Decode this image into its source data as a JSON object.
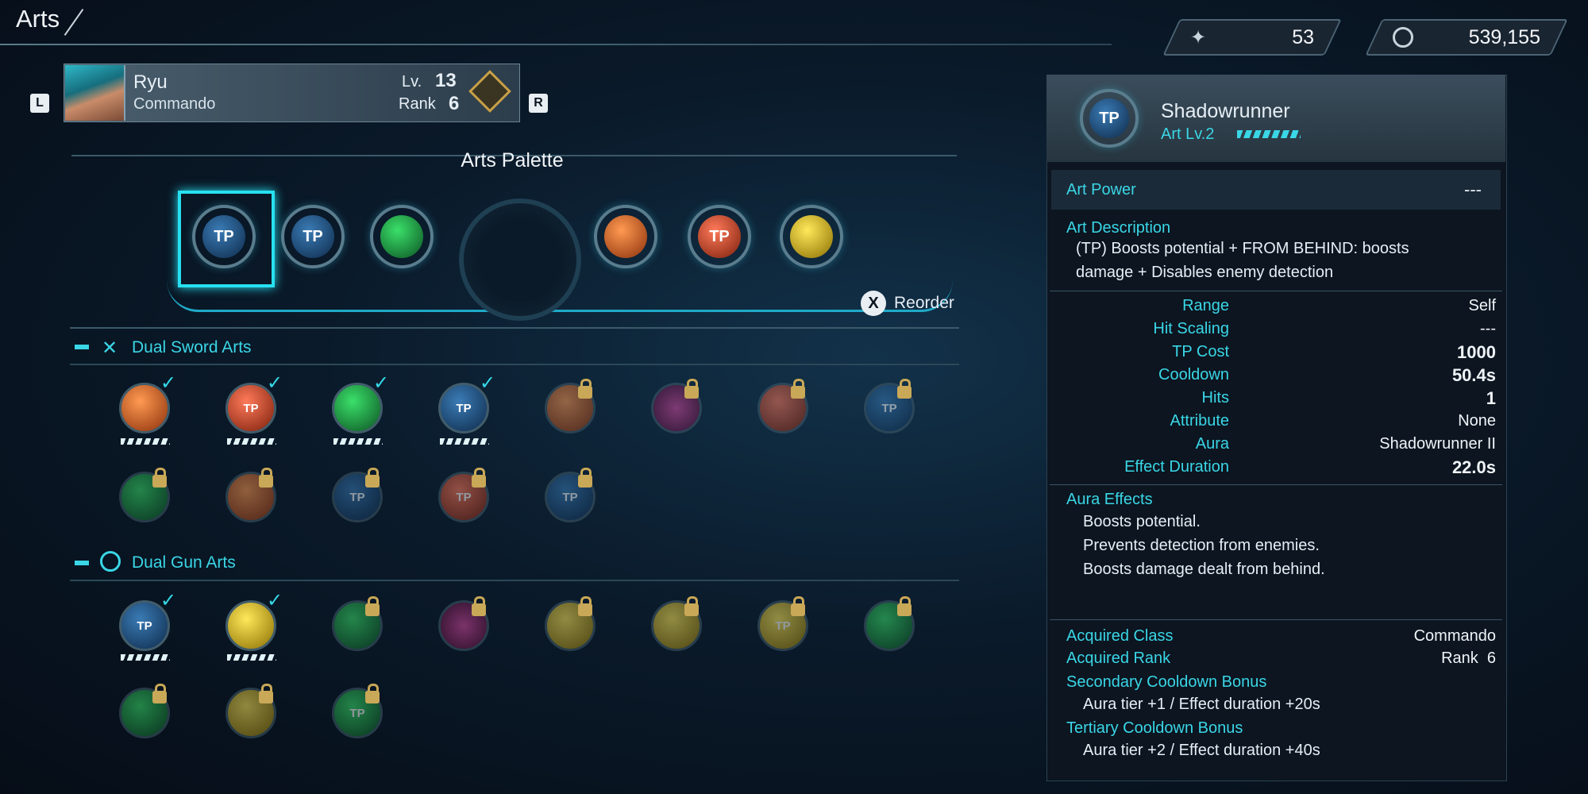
{
  "header": {
    "title": "Arts",
    "resource1_value": "53",
    "resource2_value": "539,155"
  },
  "character": {
    "name": "Ryu",
    "class": "Commando",
    "level_label": "Lv.",
    "level": "13",
    "rank_label": "Rank",
    "rank": "6",
    "left_button": "L",
    "right_button": "R"
  },
  "palette": {
    "title": "Arts Palette",
    "reorder_button": "X",
    "reorder_label": "Reorder",
    "tp_label": "TP"
  },
  "sections": {
    "sword": {
      "title": "Dual Sword Arts"
    },
    "gun": {
      "title": "Dual Gun Arts"
    }
  },
  "detail": {
    "art_name": "Shadowrunner",
    "art_level": "Art Lv.2",
    "tp_label": "TP",
    "art_power_label": "Art Power",
    "art_power_value": "---",
    "description_label": "Art Description",
    "description_line1": "(TP) Boosts potential + FROM BEHIND: boosts",
    "description_line2": "damage + Disables enemy detection",
    "stats": [
      {
        "label": "Range",
        "value": "Self"
      },
      {
        "label": "Hit Scaling",
        "value": "---"
      },
      {
        "label": "TP Cost",
        "value": "1000"
      },
      {
        "label": "Cooldown",
        "value": "50.4s"
      },
      {
        "label": "Hits",
        "value": "1"
      },
      {
        "label": "Attribute",
        "value": "None"
      },
      {
        "label": "Aura",
        "value": "Shadowrunner II"
      },
      {
        "label": "Effect Duration",
        "value": "22.0s"
      }
    ],
    "aura_effects_label": "Aura Effects",
    "aura_effects": [
      "Boosts potential.",
      "Prevents detection from enemies.",
      "Boosts damage dealt from behind."
    ],
    "acquired_class_label": "Acquired Class",
    "acquired_class_value": "Commando",
    "acquired_rank_label": "Acquired Rank",
    "acquired_rank_value": "Rank  6",
    "secondary_label": "Secondary Cooldown Bonus",
    "secondary_value": "Aura tier +1 / Effect duration +20s",
    "tertiary_label": "Tertiary Cooldown Bonus",
    "tertiary_value": "Aura tier +2 / Effect duration +40s"
  }
}
